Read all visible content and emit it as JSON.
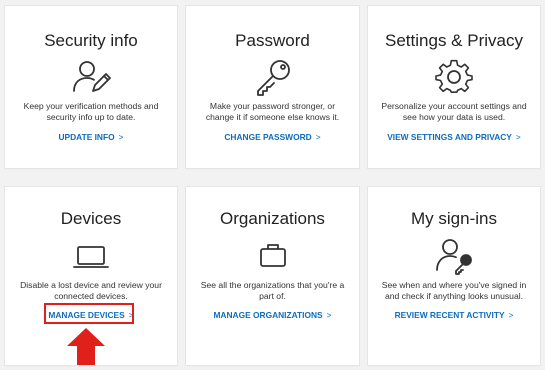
{
  "cards": [
    {
      "title": "Security info",
      "icon": "user-edit-icon",
      "description": "Keep your verification methods and security info up to date.",
      "link": "UPDATE INFO"
    },
    {
      "title": "Password",
      "icon": "key-icon",
      "description": "Make your password stronger, or change it if someone else knows it.",
      "link": "CHANGE PASSWORD"
    },
    {
      "title": "Settings & Privacy",
      "icon": "gear-icon",
      "description": "Personalize your account settings and see how your data is used.",
      "link": "VIEW SETTINGS AND PRIVACY"
    },
    {
      "title": "Devices",
      "icon": "laptop-icon",
      "description": "Disable a lost device and review your connected devices.",
      "link": "MANAGE DEVICES"
    },
    {
      "title": "Organizations",
      "icon": "briefcase-icon",
      "description": "See all the organizations that you're a part of.",
      "link": "MANAGE ORGANIZATIONS"
    },
    {
      "title": "My sign-ins",
      "icon": "user-key-icon",
      "description": "See when and where you've signed in and check if anything looks unusual.",
      "link": "REVIEW RECENT ACTIVITY"
    }
  ],
  "chevron": ">",
  "colors": {
    "link": "#0f6cbd",
    "highlight": "#e0201b",
    "background": "#f2f2f2"
  }
}
